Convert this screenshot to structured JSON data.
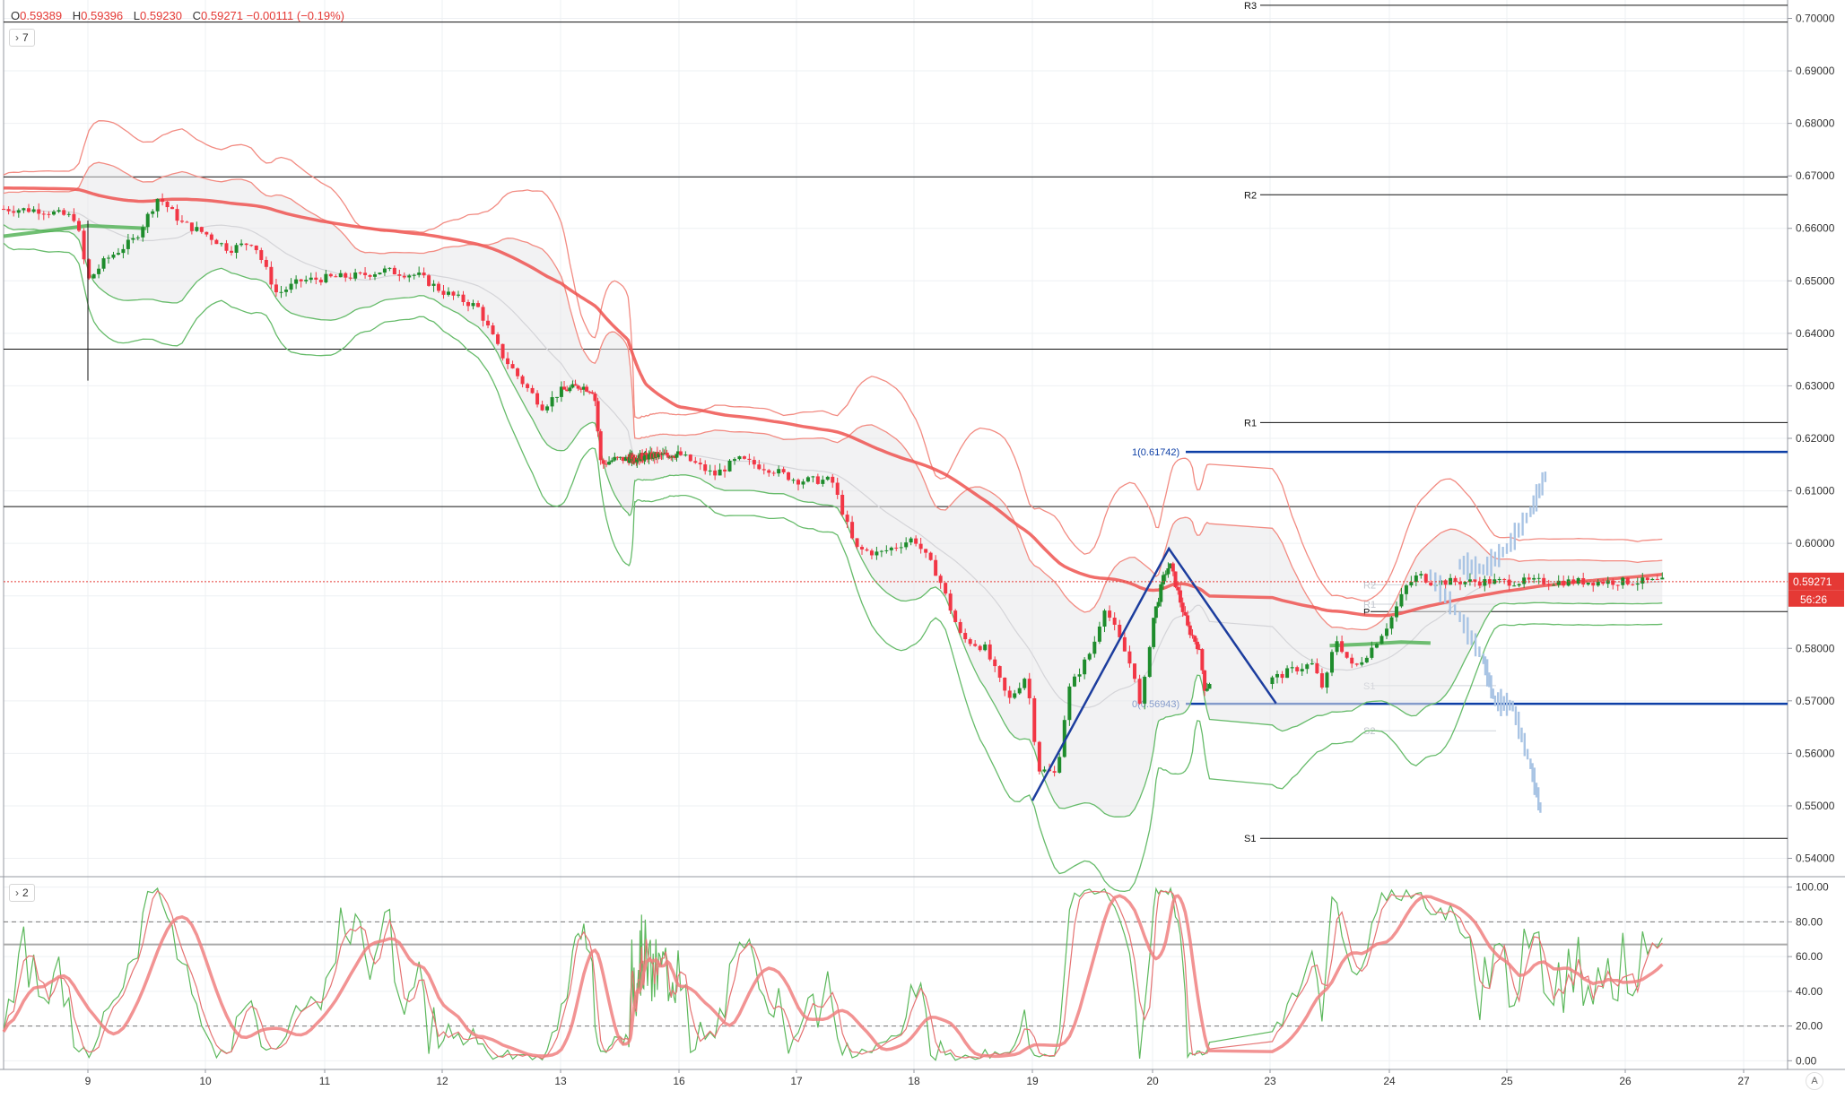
{
  "header": {
    "ohlc": [
      {
        "label": "O",
        "value": "0.59389"
      },
      {
        "label": "H",
        "value": "0.59396"
      },
      {
        "label": "L",
        "value": "0.59230"
      },
      {
        "label": "C",
        "value": "0.59271 −0.00111 (−0.19%)"
      }
    ]
  },
  "legend_main": {
    "count": "7",
    "icon": "chevron-right-icon"
  },
  "legend_osc": {
    "count": "2",
    "icon": "chevron-right-icon"
  },
  "auto_label": "A",
  "colors": {
    "up": "#1e8c2c",
    "down": "#f23645",
    "ema": "#ef5350",
    "ma_green": "#4caf50",
    "band_red": "#f28b82",
    "band_green": "#66bb6a",
    "fib": "#0d3fa6",
    "pattern": "#1c3d9e",
    "price_line": "#e53935",
    "projection": "#a9c4e4",
    "pivot": "#000000"
  },
  "chart_data": [
    {
      "type": "candlestick",
      "x_ticks": [
        "9",
        "10",
        "11",
        "12",
        "13",
        "16",
        "17",
        "18",
        "19",
        "20",
        "23",
        "24",
        "25",
        "26",
        "27"
      ],
      "y_ticks": [
        "0.70000",
        "0.69000",
        "0.68000",
        "0.67000",
        "0.66000",
        "0.65000",
        "0.64000",
        "0.63000",
        "0.62000",
        "0.61000",
        "0.60000",
        "0.59000",
        "0.58000",
        "0.57000",
        "0.56000",
        "0.55000",
        "0.54000"
      ],
      "ylim": [
        0.5365,
        0.7035
      ],
      "last_price": "0.59271",
      "countdown": "56:26",
      "pivot_levels": [
        {
          "label": "R3",
          "value": 0.7025
        },
        {
          "label": "R2",
          "value": 0.6664
        },
        {
          "label": "R1",
          "value": 0.623
        },
        {
          "label": "S1",
          "value": 0.5438
        }
      ],
      "fib_levels": [
        {
          "label": "1(0.61742)",
          "value": 0.61742
        },
        {
          "label": "0(0.56943)",
          "value": 0.56943
        }
      ],
      "minor_pivots": [
        {
          "label": "R2",
          "value": 0.5921
        },
        {
          "label": "R1",
          "value": 0.5884
        },
        {
          "label": "P",
          "value": 0.587
        },
        {
          "label": "S1",
          "value": 0.5729
        },
        {
          "label": "S2",
          "value": 0.5643
        }
      ],
      "horizontal_lines": [
        0.6993,
        0.6698,
        0.637,
        0.607
      ],
      "candles": {
        "x_start": 8.3,
        "x_end": 24.35,
        "closes": [
          [
            8.3,
            0.6637
          ],
          [
            8.6,
            0.6635
          ],
          [
            8.9,
            0.662
          ],
          [
            9.0,
            0.65
          ],
          [
            9.15,
            0.654
          ],
          [
            9.4,
            0.658
          ],
          [
            9.6,
            0.666
          ],
          [
            9.8,
            0.661
          ],
          [
            10.0,
            0.659
          ],
          [
            10.2,
            0.656
          ],
          [
            10.4,
            0.6575
          ],
          [
            10.6,
            0.6475
          ],
          [
            10.8,
            0.65
          ],
          [
            11.0,
            0.6505
          ],
          [
            11.3,
            0.651
          ],
          [
            11.5,
            0.652
          ],
          [
            11.8,
            0.651
          ],
          [
            12.0,
            0.648
          ],
          [
            12.3,
            0.645
          ],
          [
            12.5,
            0.636
          ],
          [
            12.7,
            0.63
          ],
          [
            12.85,
            0.626
          ],
          [
            13.0,
            0.629
          ],
          [
            13.3,
            0.63
          ],
          [
            13.5,
            0.629
          ],
          [
            13.6,
            0.615
          ],
          [
            13.8,
            0.616
          ],
          [
            16.0,
            0.617
          ],
          [
            16.3,
            0.613
          ],
          [
            16.5,
            0.616
          ],
          [
            16.8,
            0.614
          ],
          [
            17.0,
            0.612
          ],
          [
            17.3,
            0.612
          ],
          [
            17.5,
            0.599
          ],
          [
            17.7,
            0.598
          ],
          [
            17.9,
            0.6
          ],
          [
            18.0,
            0.601
          ],
          [
            18.2,
            0.594
          ],
          [
            18.4,
            0.582
          ],
          [
            18.6,
            0.58
          ],
          [
            18.8,
            0.57
          ],
          [
            18.95,
            0.575
          ],
          [
            19.05,
            0.557
          ],
          [
            19.2,
            0.556
          ],
          [
            19.3,
            0.572
          ],
          [
            19.5,
            0.58
          ],
          [
            19.6,
            0.588
          ],
          [
            19.7,
            0.583
          ],
          [
            19.85,
            0.575
          ],
          [
            19.9,
            0.568
          ],
          [
            20.0,
            0.585
          ],
          [
            20.2,
            0.594
          ],
          [
            20.3,
            0.596
          ],
          [
            20.4,
            0.592
          ],
          [
            20.6,
            0.584
          ],
          [
            20.8,
            0.58
          ],
          [
            20.9,
            0.572
          ],
          [
            21.0,
            0.574
          ],
          [
            21.2,
            0.576
          ],
          [
            21.35,
            0.577
          ],
          [
            21.45,
            0.572
          ],
          [
            21.55,
            0.582
          ],
          [
            21.7,
            0.576
          ],
          [
            21.85,
            0.58
          ],
          [
            22.0,
            0.585
          ],
          [
            22.15,
            0.592
          ],
          [
            22.25,
            0.594
          ],
          [
            22.35,
            0.5927
          ]
        ]
      },
      "series": [
        {
          "name": "",
          "points": [
            [
              8.3,
              0.6585
            ],
            [
              9.0,
              0.6605
            ],
            [
              9.5,
              0.66
            ]
          ]
        }
      ]
    },
    {
      "type": "line",
      "y_ticks": [
        "100.00",
        "80.00",
        "60.00",
        "40.00",
        "20.00",
        "0.00"
      ],
      "ylim": [
        -5,
        105
      ],
      "dashed_levels": [
        80,
        20
      ],
      "solid_level": 67
    }
  ]
}
